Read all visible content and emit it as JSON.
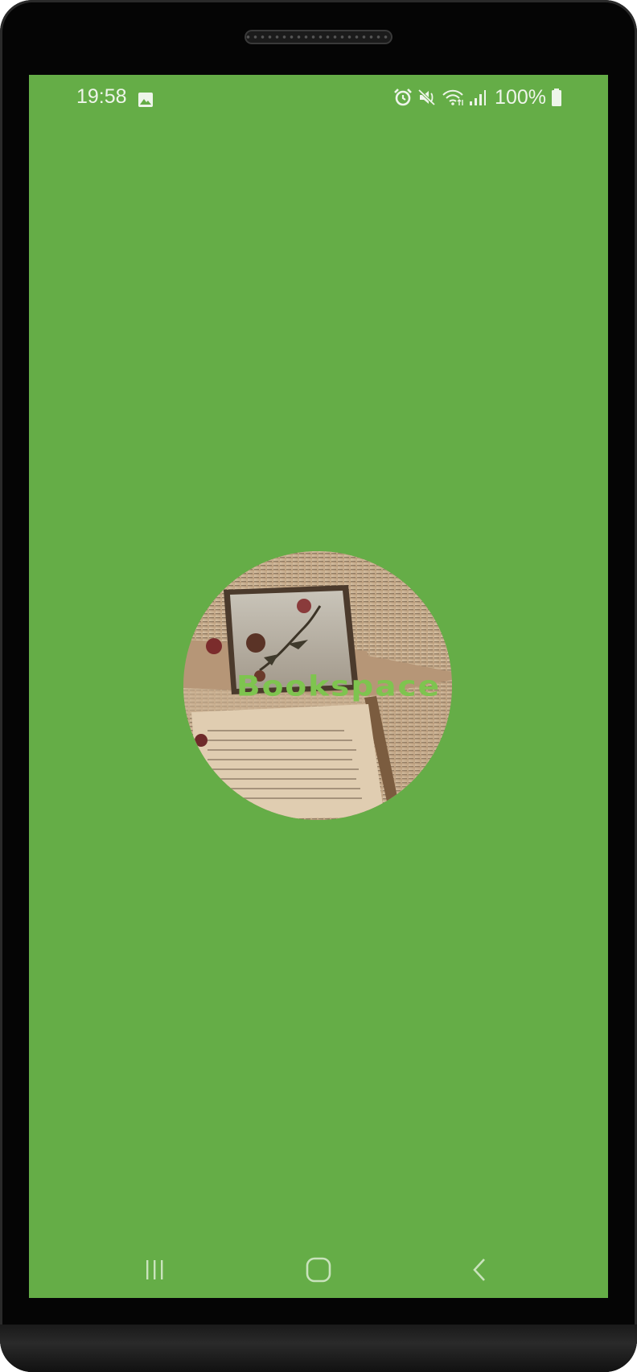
{
  "status_bar": {
    "time": "19:58",
    "battery": "100%",
    "icons": [
      "image-icon",
      "alarm-icon",
      "mute-icon",
      "wifi-icon",
      "signal-icon",
      "battery-icon"
    ]
  },
  "splash": {
    "app_name": "Bookspace",
    "background_color": "#65ad47",
    "title_color": "#7ec44f",
    "logo_image": "photo of open books with a dried rose and a small mirror"
  },
  "nav_bar": {
    "buttons": [
      "recent-apps-icon",
      "home-icon",
      "back-icon"
    ]
  }
}
